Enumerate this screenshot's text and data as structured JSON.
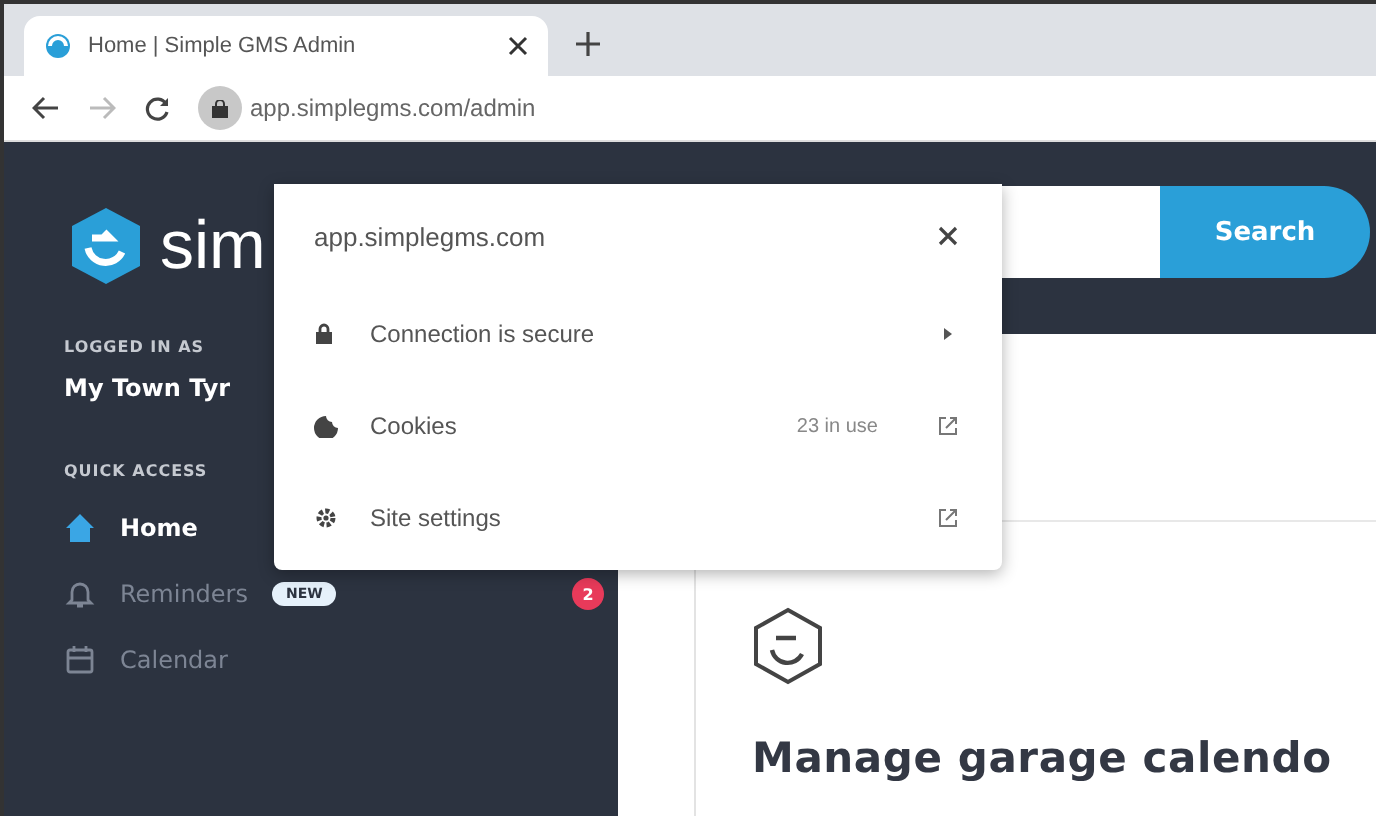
{
  "browser": {
    "tab": {
      "title": "Home | Simple GMS Admin",
      "selected": true
    },
    "address": "app.simplegms.com/admin"
  },
  "site_info": {
    "domain": "app.simplegms.com",
    "rows": [
      {
        "kind": "submenu",
        "label": "Connection is secure"
      },
      {
        "kind": "link",
        "label": "Cookies",
        "value": "23 in use"
      },
      {
        "kind": "link",
        "label": "Site settings"
      }
    ]
  },
  "sidebar": {
    "logo_text": "sim",
    "logged_in_label": "LOGGED IN AS",
    "account": "My Town Tyr",
    "section": "QUICK ACCESS",
    "items": [
      {
        "label": "Home",
        "selected": true
      },
      {
        "label": "Reminders",
        "selected": false,
        "badge": "NEW",
        "count": "2"
      },
      {
        "label": "Calendar",
        "selected": false
      }
    ]
  },
  "header": {
    "search_button": "Search"
  },
  "main": {
    "heading": "Manage garage calendo"
  }
}
